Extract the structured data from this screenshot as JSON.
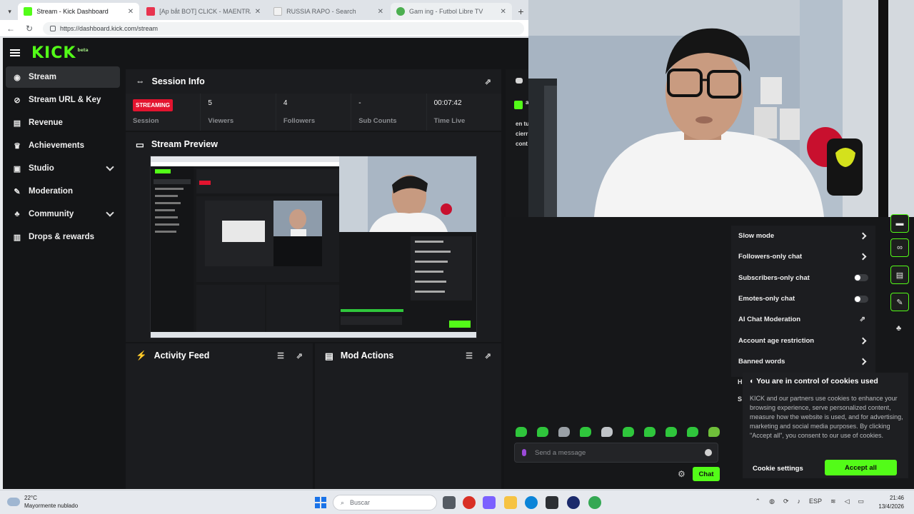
{
  "browser": {
    "tabs": [
      {
        "label": "Stream - Kick Dashboard",
        "fav_color": "#53fc18",
        "active": true
      },
      {
        "label": "[Ap bắt BOT] CLICK - MAENTRA",
        "fav_color": "#e8344f",
        "active": false
      },
      {
        "label": "RUSSIA RAPO - Search",
        "fav_color": "#f2f2f2",
        "active": false
      },
      {
        "label": "Gam ing - Futbol Libre TV",
        "fav_color": "#4caf50",
        "active": true
      }
    ],
    "url": "https://dashboard.kick.com/stream"
  },
  "app": {
    "logo": "KICK",
    "logo_badge": "beta",
    "nav": [
      {
        "label": "Stream",
        "icon": "broadcast-icon"
      },
      {
        "label": "Stream URL & Key",
        "icon": "link-icon"
      },
      {
        "label": "Revenue",
        "icon": "money-icon"
      },
      {
        "label": "Achievements",
        "icon": "trophy-icon"
      },
      {
        "label": "Studio",
        "icon": "studio-icon"
      },
      {
        "label": "Moderation",
        "icon": "wrench-icon"
      },
      {
        "label": "Community",
        "icon": "community-icon"
      },
      {
        "label": "Drops & rewards",
        "icon": "gift-icon"
      }
    ],
    "session": {
      "title": "Session Info",
      "status": "STREAMING",
      "status_label": "Session",
      "stats": [
        {
          "value": "5",
          "label": "Viewers"
        },
        {
          "value": "4",
          "label": "Followers"
        },
        {
          "value": "-",
          "label": "Sub Counts"
        },
        {
          "value": "00:07:42",
          "label": "Time Live"
        }
      ]
    },
    "preview_title": "Stream Preview",
    "activity_title": "Activity Feed",
    "mod_title": "Mod Actions",
    "chat_snippet": [
      "andr",
      "en tu",
      "cierr",
      "cont"
    ]
  },
  "chat_settings": {
    "items": [
      {
        "label": "Slow mode",
        "control": "chevron"
      },
      {
        "label": "Followers-only chat",
        "control": "chevron"
      },
      {
        "label": "Subscribers-only chat",
        "control": "toggle"
      },
      {
        "label": "Emotes-only chat",
        "control": "toggle"
      },
      {
        "label": "AI Chat Moderation",
        "control": "external"
      },
      {
        "label": "Account age restriction",
        "control": "chevron"
      },
      {
        "label": "Banned words",
        "control": "chevron"
      }
    ]
  },
  "cookie": {
    "title": "You are in control of cookies used",
    "text": "KICK and our partners use cookies to enhance your browsing experience, serve personalized content, measure how the website is used, and for advertising, marketing and social media purposes. By clicking \"Accept all\", you consent to our use of cookies.",
    "settings_label": "Cookie settings",
    "accept_label": "Accept all"
  },
  "chat": {
    "placeholder": "Send a message",
    "send_label": "Chat"
  },
  "taskbar": {
    "weather_temp": "22°C",
    "weather_desc": "Mayormente nublado",
    "search_placeholder": "Buscar",
    "lang": "ESP",
    "time": "21:46",
    "date": "13/4/2026"
  },
  "colors": {
    "accent": "#53fc18",
    "live": "#e3142f"
  }
}
